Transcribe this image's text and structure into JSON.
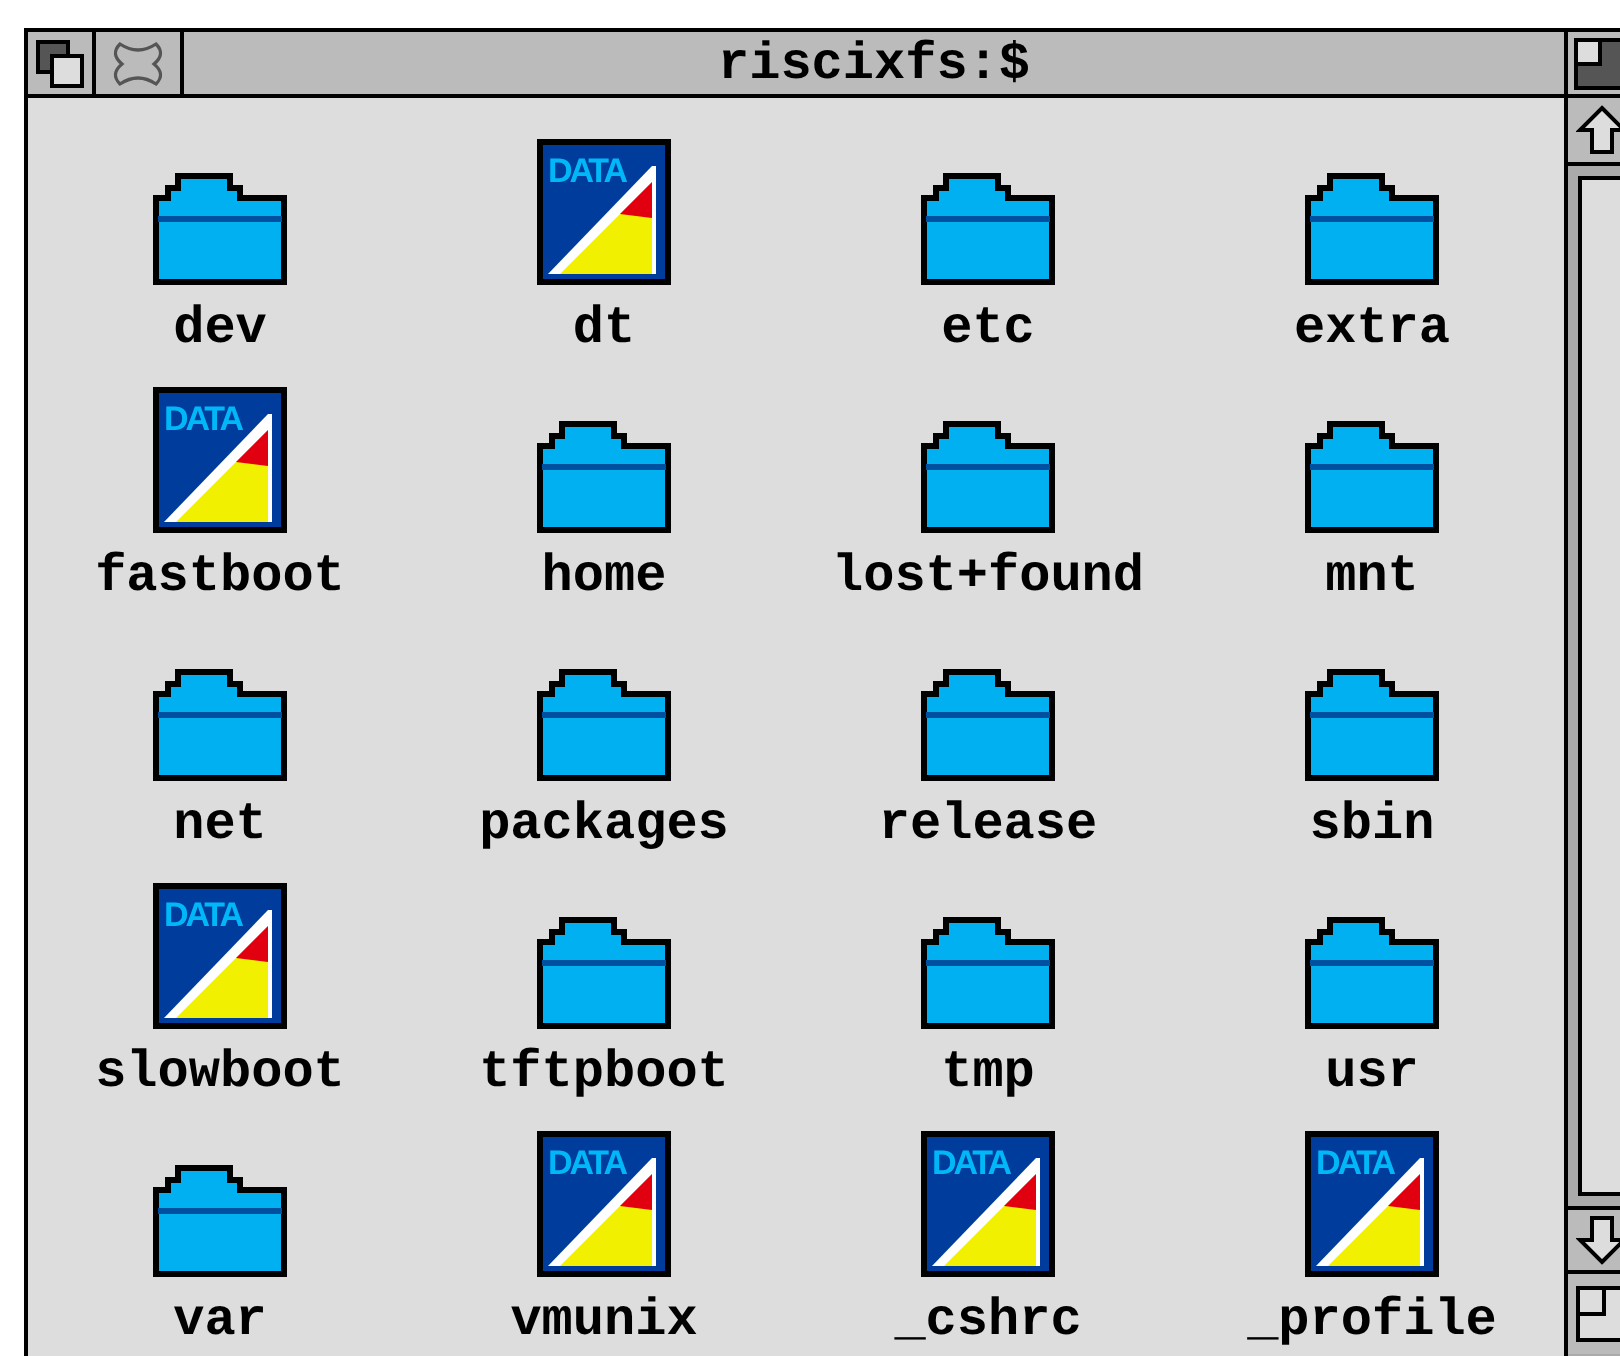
{
  "window": {
    "title": "riscixfs:$"
  },
  "items": [
    {
      "name": "dev",
      "kind": "directory"
    },
    {
      "name": "dt",
      "kind": "data",
      "icon_text": "DATA"
    },
    {
      "name": "etc",
      "kind": "directory"
    },
    {
      "name": "extra",
      "kind": "directory"
    },
    {
      "name": "fastboot",
      "kind": "data",
      "icon_text": "DATA"
    },
    {
      "name": "home",
      "kind": "directory"
    },
    {
      "name": "lost+found",
      "kind": "directory"
    },
    {
      "name": "mnt",
      "kind": "directory"
    },
    {
      "name": "net",
      "kind": "directory"
    },
    {
      "name": "packages",
      "kind": "directory"
    },
    {
      "name": "release",
      "kind": "directory"
    },
    {
      "name": "sbin",
      "kind": "directory"
    },
    {
      "name": "slowboot",
      "kind": "data",
      "icon_text": "DATA"
    },
    {
      "name": "tftpboot",
      "kind": "directory"
    },
    {
      "name": "tmp",
      "kind": "directory"
    },
    {
      "name": "usr",
      "kind": "directory"
    },
    {
      "name": "var",
      "kind": "directory"
    },
    {
      "name": "vmunix",
      "kind": "data",
      "icon_text": "DATA"
    },
    {
      "name": "_cshrc",
      "kind": "data",
      "icon_text": "DATA"
    },
    {
      "name": "_profile",
      "kind": "data",
      "icon_text": "DATA"
    }
  ]
}
